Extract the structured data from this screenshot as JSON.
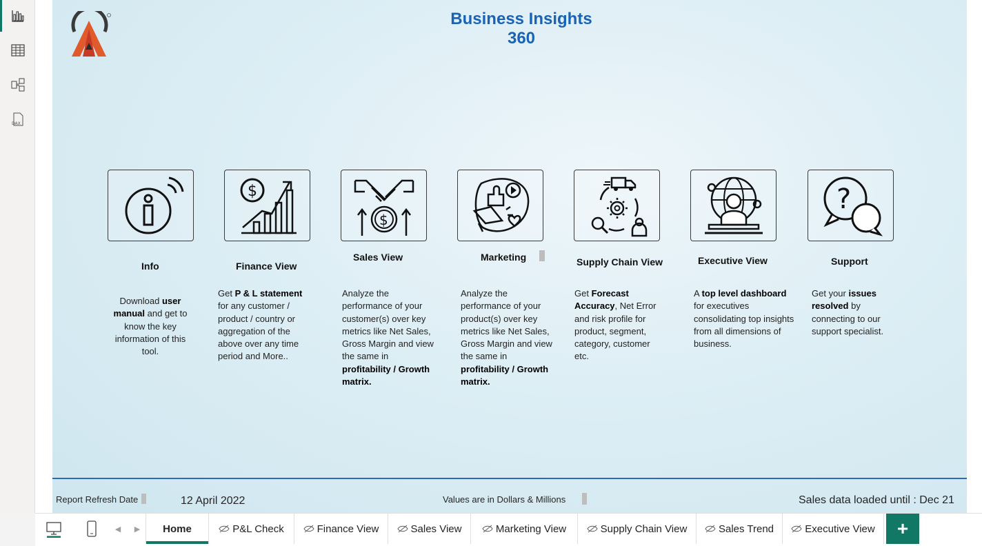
{
  "app": {
    "title": "Business Insights 360"
  },
  "rail": [
    {
      "name": "report-view-icon"
    },
    {
      "name": "table-view-icon"
    },
    {
      "name": "model-view-icon"
    },
    {
      "name": "dax-query-view-icon",
      "label": "DAX"
    }
  ],
  "sections": [
    {
      "title": "Info",
      "icon": "info-icon"
    },
    {
      "title": "Finance View",
      "icon": "finance-chart-icon"
    },
    {
      "title": "Sales View",
      "icon": "handshake-dollar-icon"
    },
    {
      "title": "Marketing",
      "icon": "megaphone-icon"
    },
    {
      "title": "Supply Chain View",
      "icon": "supply-chain-icon"
    },
    {
      "title": "Executive View",
      "icon": "executive-globe-icon"
    },
    {
      "title": "Support",
      "icon": "question-chat-icon"
    }
  ],
  "descriptions": {
    "info": {
      "a": "Download ",
      "b": "user manual",
      "c": " and get to know the key information of this tool."
    },
    "finance": {
      "a": "Get ",
      "b": " P & L statement",
      "c": " for any customer / product / country or aggregation of the above over any time period and More.."
    },
    "sales": {
      "a": "Analyze the performance of your customer(s) over key metrics like Net Sales, Gross Margin and view the same in ",
      "b": "profitability / Growth matrix."
    },
    "marketing": {
      "a": "Analyze the performance of your product(s) over key metrics like Net Sales, Gross Margin and view the same in ",
      "b": "profitability / Growth matrix."
    },
    "supply": {
      "a": "Get ",
      "b": "Forecast Accuracy",
      "c": ", Net Error and risk profile for product, segment, category, customer etc."
    },
    "executive": {
      "a": "A ",
      "b": "top level dashboard",
      "c": " for executives consolidating top insights from all dimensions of business."
    },
    "support": {
      "a": "Get your ",
      "b": "issues resolved",
      "c": " by connecting to our support specialist."
    }
  },
  "footer": {
    "refresh_label": "Report Refresh Date",
    "refresh_date": "12 April 2022",
    "units_note": "Values are in Dollars & Millions",
    "loaded_until": "Sales data loaded until : Dec 21"
  },
  "tabs": [
    {
      "label": "Home",
      "active": true,
      "hidden": false
    },
    {
      "label": "P&L Check",
      "active": false,
      "hidden": true
    },
    {
      "label": "Finance View",
      "active": false,
      "hidden": true
    },
    {
      "label": "Sales View",
      "active": false,
      "hidden": true
    },
    {
      "label": "Marketing View",
      "active": false,
      "hidden": true
    },
    {
      "label": "Supply Chain View",
      "active": false,
      "hidden": true
    },
    {
      "label": "Sales Trend",
      "active": false,
      "hidden": true
    },
    {
      "label": "Executive View",
      "active": false,
      "hidden": true
    }
  ],
  "add_tab": "+",
  "colors": {
    "accent": "#117865",
    "title": "#1a63b4",
    "rule": "#2b6bb5"
  }
}
